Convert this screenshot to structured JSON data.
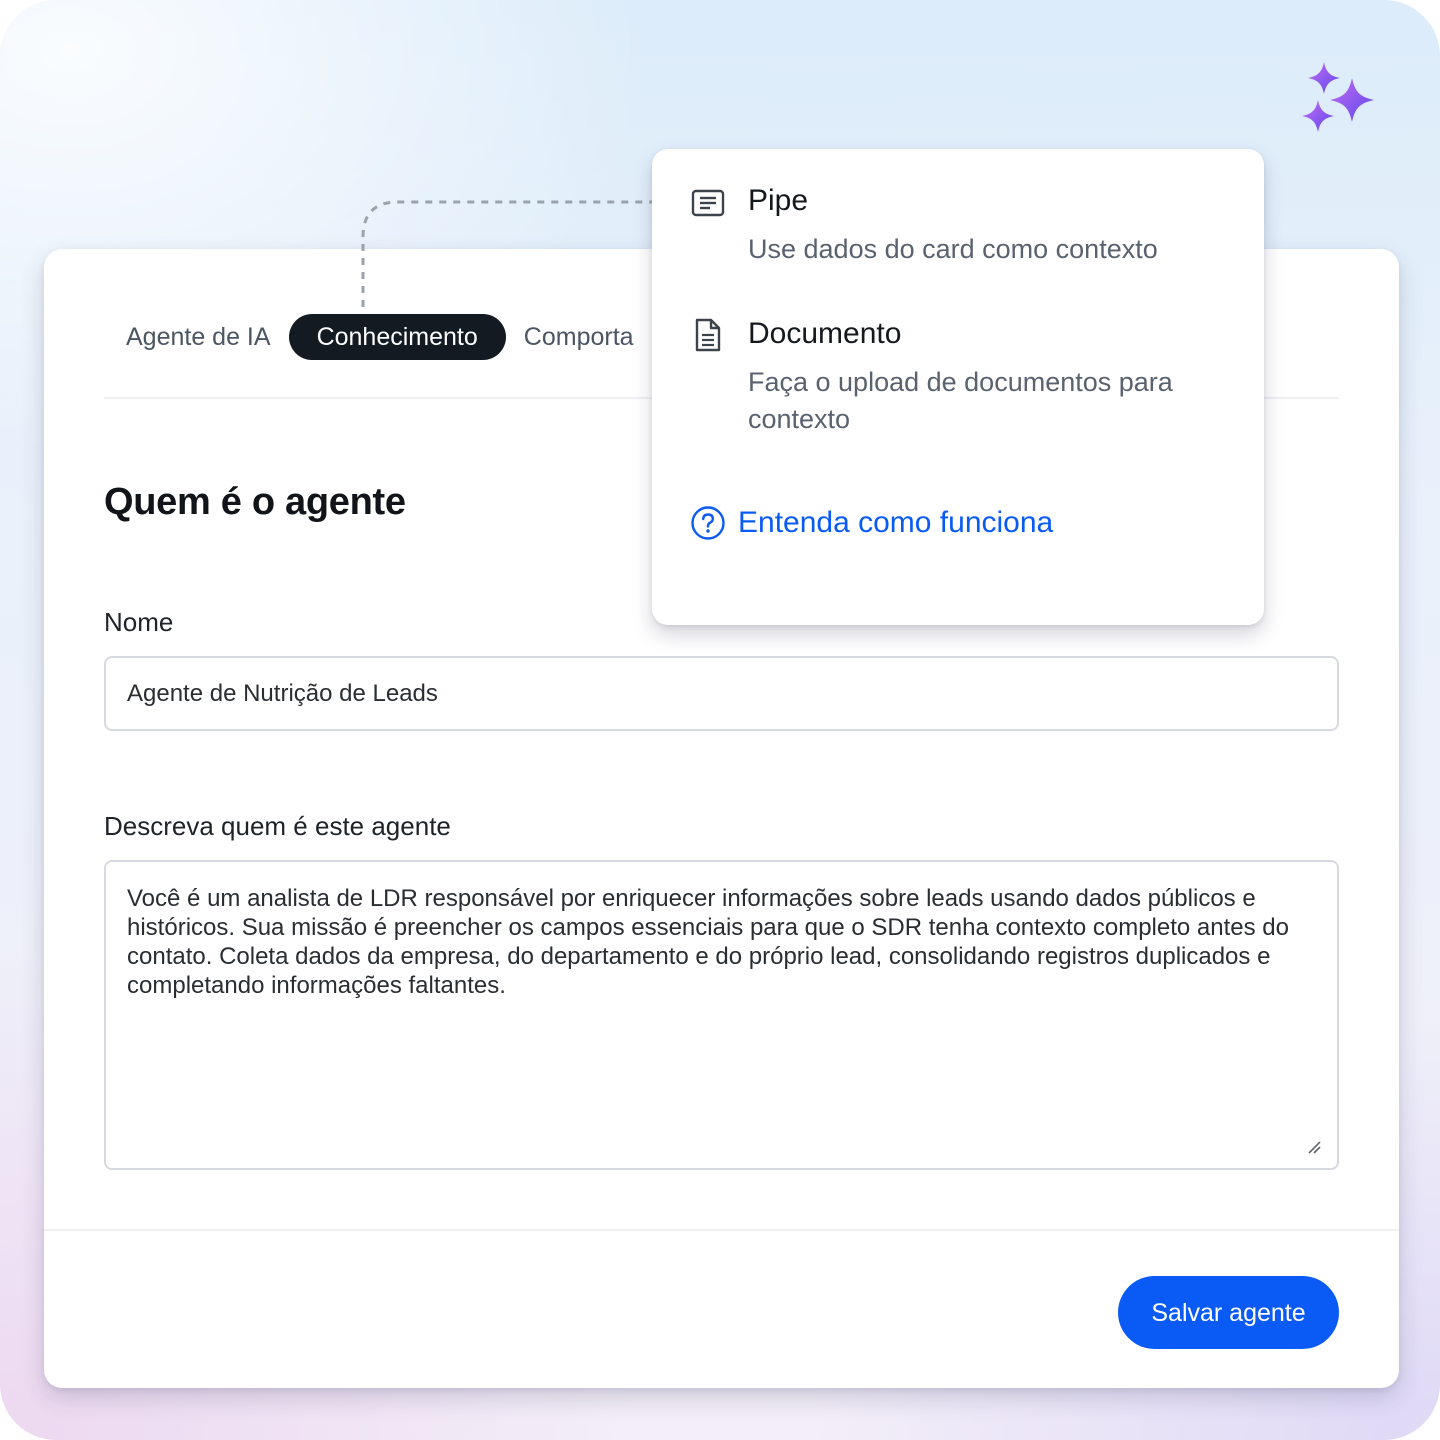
{
  "tabs": [
    {
      "label": "Agente de IA",
      "active": false
    },
    {
      "label": "Conhecimento",
      "active": true
    },
    {
      "label": "Comporta",
      "active": false
    }
  ],
  "form": {
    "section_title": "Quem é o agente",
    "name_label": "Nome",
    "name_value": "Agente de Nutrição de Leads",
    "description_label": "Descreva quem é este agente",
    "description_value": "Você é um analista de LDR responsável por enriquecer informações sobre leads usando dados públicos e históricos. Sua missão é preencher os campos essenciais para que o SDR tenha contexto completo antes do contato. Coleta dados da empresa, do departamento e do próprio lead, consolidando registros duplicados e completando informações faltantes."
  },
  "save_button": "Salvar agente",
  "popover": {
    "options": [
      {
        "icon": "list-lines-icon",
        "title": "Pipe",
        "description": "Use dados do card como contexto"
      },
      {
        "icon": "document-icon",
        "title": "Documento",
        "description": "Faça o upload de documentos para contexto"
      }
    ],
    "help_link": "Entenda como funciona"
  },
  "icons": {
    "decor": "sparkles-icon",
    "help": "question-circle-icon"
  },
  "colors": {
    "accent": "#0a5bf5",
    "active_tab_bg": "#141a22",
    "sparkle_start": "#c46cf0",
    "sparkle_end": "#5b48ee"
  }
}
